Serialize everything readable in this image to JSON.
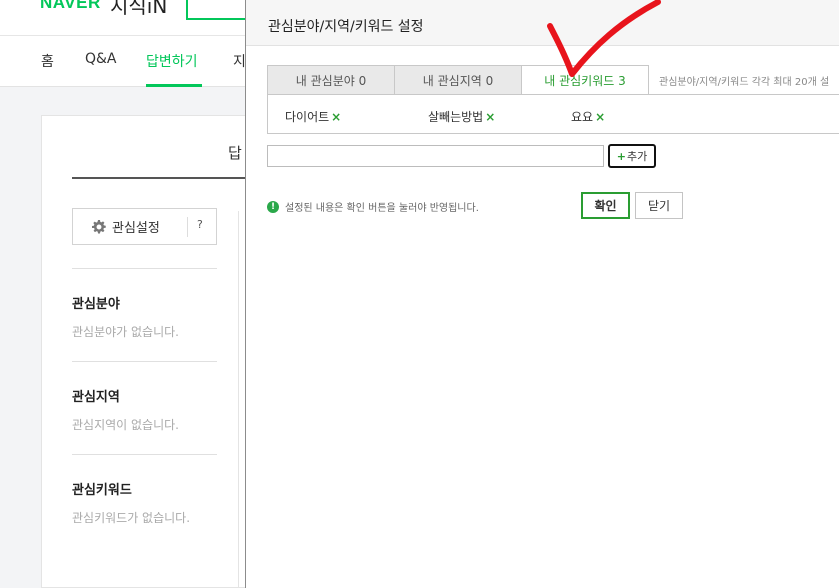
{
  "header": {
    "logo_brand": "NAVER",
    "logo_service": "지식iN"
  },
  "nav": {
    "items": [
      {
        "label": "홈",
        "active": false
      },
      {
        "label": "Q&A",
        "active": false
      },
      {
        "label": "답변하기",
        "active": true
      },
      {
        "label": "지",
        "active": false
      }
    ]
  },
  "content": {
    "title": "답",
    "interest_button": {
      "label": "관심설정",
      "help": "?",
      "icon": "gear-icon"
    },
    "sections": [
      {
        "heading": "관심분야",
        "empty_text": "관심분야가 없습니다."
      },
      {
        "heading": "관심지역",
        "empty_text": "관심지역이 없습니다."
      },
      {
        "heading": "관심키워드",
        "empty_text": "관심키워드가 없습니다."
      }
    ]
  },
  "modal": {
    "title": "관심분야/지역/키워드 설정",
    "tabs": [
      {
        "label": "내 관심분야 0",
        "active": false
      },
      {
        "label": "내 관심지역 0",
        "active": false
      },
      {
        "label": "내 관심키워드 3",
        "active": true
      }
    ],
    "tab_note": "관심분야/지역/키워드 각각 최대 20개 설",
    "keywords": [
      {
        "label": "다이어트",
        "remove": "×"
      },
      {
        "label": "살빼는방법",
        "remove": "×"
      },
      {
        "label": "요요",
        "remove": "×"
      }
    ],
    "keyword_input": {
      "value": "",
      "placeholder": ""
    },
    "add_button": {
      "icon": "+",
      "label": "추가"
    },
    "notice": {
      "icon": "!",
      "text": "설정된 내용은 확인 버튼을 눌러야 반영됩니다."
    },
    "confirm_label": "확인",
    "close_label": "닫기"
  },
  "colors": {
    "brand_green": "#03c75a",
    "accent_green": "#2a9d32",
    "annotation_red": "#e8141c"
  }
}
